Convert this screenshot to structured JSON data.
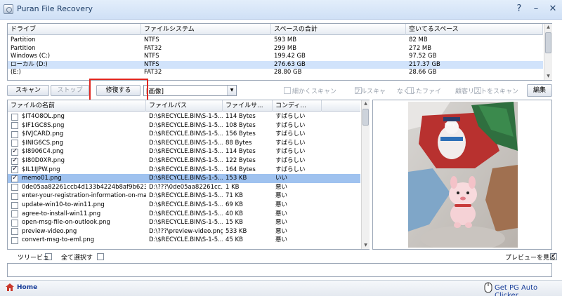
{
  "window": {
    "title": "Puran File Recovery",
    "help": "?",
    "minimize": "–",
    "close": "✕"
  },
  "drives": {
    "columns": [
      "ドライブ",
      "ファイルシステム",
      "スペースの合計",
      "空いてるスペース"
    ],
    "rows": [
      [
        "Partition",
        "NTFS",
        "593 MB",
        "82 MB"
      ],
      [
        "Partition",
        "FAT32",
        "299 MB",
        "272 MB"
      ],
      [
        "Windows (C:)",
        "NTFS",
        "199.42 GB",
        "97.52 GB"
      ],
      [
        "ローカル (D:)",
        "NTFS",
        "276.63 GB",
        "217.37 GB"
      ],
      [
        "(E:)",
        "FAT32",
        "28.80 GB",
        "28.66 GB"
      ]
    ],
    "selected_index": 3
  },
  "toolbar": {
    "scan": "スキャン",
    "stop": "ストップ",
    "repair": "修復する",
    "filter_value": "[画像]",
    "deep_scan": "細かくスキャン",
    "full_scan": "フルスキャ",
    "lost_files": "なくしたファイ",
    "deleted_list": "顧客リストをスキャン",
    "edit": "編集"
  },
  "files": {
    "columns": [
      "ファイルの名前",
      "ファイルパス",
      "ファイルサ...",
      "コンディ..."
    ],
    "rows": [
      {
        "name": "$IT4O8OL.png",
        "path": "D:\\$RECYCLE.BIN\\S-1-5...",
        "size": "114 Bytes",
        "cond": "すばらしい",
        "checked": false
      },
      {
        "name": "$IF1GC8S.png",
        "path": "D:\\$RECYCLE.BIN\\S-1-5...",
        "size": "108 Bytes",
        "cond": "すばらしい",
        "checked": false
      },
      {
        "name": "$IVJCARD.png",
        "path": "D:\\$RECYCLE.BIN\\S-1-5...",
        "size": "156 Bytes",
        "cond": "すばらしい",
        "checked": false
      },
      {
        "name": "$INIG6CS.png",
        "path": "D:\\$RECYCLE.BIN\\S-1-5...",
        "size": "88 Bytes",
        "cond": "すばらしい",
        "checked": false
      },
      {
        "name": "$I8906C4.png",
        "path": "D:\\$RECYCLE.BIN\\S-1-5...",
        "size": "114 Bytes",
        "cond": "すばらしい",
        "checked": true
      },
      {
        "name": "$I80D0XR.png",
        "path": "D:\\$RECYCLE.BIN\\S-1-5...",
        "size": "122 Bytes",
        "cond": "すばらしい",
        "checked": true
      },
      {
        "name": "$IL1IJPW.png",
        "path": "D:\\$RECYCLE.BIN\\S-1-5...",
        "size": "164 Bytes",
        "cond": "すばらしい",
        "checked": true
      },
      {
        "name": "memo01.png",
        "path": "D:\\$RECYCLE.BIN\\S-1-5...",
        "size": "153 KB",
        "cond": "いい",
        "checked": true
      },
      {
        "name": "0de05aa82261ccb4d133b4224b8af9b623151...",
        "path": "D:\\???\\0de05aa82261cc...",
        "size": "1 KB",
        "cond": "悪い",
        "checked": false
      },
      {
        "name": "enter-your-registration-information-on-mac.jpg",
        "path": "D:\\$RECYCLE.BIN\\S-1-5...",
        "size": "71 KB",
        "cond": "悪い",
        "checked": false
      },
      {
        "name": "update-win10-to-win11.png",
        "path": "D:\\$RECYCLE.BIN\\S-1-5...",
        "size": "69 KB",
        "cond": "悪い",
        "checked": false
      },
      {
        "name": "agree-to-install-win11.png",
        "path": "D:\\$RECYCLE.BIN\\S-1-5...",
        "size": "40 KB",
        "cond": "悪い",
        "checked": false
      },
      {
        "name": "open-msg-file-on-outlook.png",
        "path": "D:\\$RECYCLE.BIN\\S-1-5...",
        "size": "15 KB",
        "cond": "悪い",
        "checked": false
      },
      {
        "name": "preview-video.png",
        "path": "D:\\???\\preview-video.png",
        "size": "533 KB",
        "cond": "悪い",
        "checked": false
      },
      {
        "name": "convert-msg-to-eml.png",
        "path": "D:\\$RECYCLE.BIN\\S-1-5...",
        "size": "45 KB",
        "cond": "悪い",
        "checked": false
      }
    ],
    "selected_index": 7
  },
  "bottom": {
    "tree": "ツリービュ",
    "select_all": "全て選択す",
    "preview": "プレビューを見る"
  },
  "status": {
    "home": "Home",
    "promo": "Get PG Auto Clicker"
  },
  "colors": {
    "highlight": "#e0261f",
    "title_text": "#1f3f68",
    "link": "#1a3f9a"
  }
}
